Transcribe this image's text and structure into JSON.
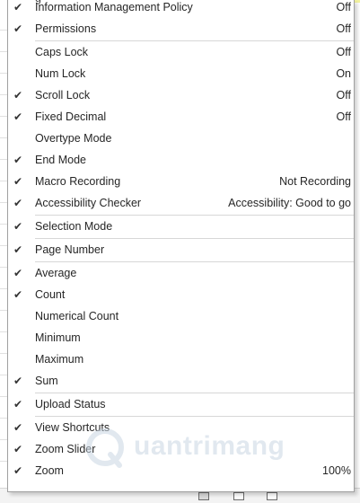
{
  "menu": {
    "partial_top": "g",
    "items": [
      {
        "label": "Information Management Policy",
        "value": "Off",
        "checked": true
      },
      {
        "label": "Permissions",
        "value": "Off",
        "checked": true
      },
      {
        "label": "Caps Lock",
        "value": "Off",
        "checked": false
      },
      {
        "label": "Num Lock",
        "value": "On",
        "checked": false
      },
      {
        "label": "Scroll Lock",
        "value": "Off",
        "checked": true
      },
      {
        "label": "Fixed Decimal",
        "value": "Off",
        "checked": true
      },
      {
        "label": "Overtype Mode",
        "value": "",
        "checked": false
      },
      {
        "label": "End Mode",
        "value": "",
        "checked": true
      },
      {
        "label": "Macro Recording",
        "value": "Not Recording",
        "checked": true
      },
      {
        "label": "Accessibility Checker",
        "value": "Accessibility: Good to go",
        "checked": true
      },
      {
        "label": "Selection Mode",
        "value": "",
        "checked": true
      },
      {
        "label": "Page Number",
        "value": "",
        "checked": true
      },
      {
        "label": "Average",
        "value": "",
        "checked": true
      },
      {
        "label": "Count",
        "value": "",
        "checked": true
      },
      {
        "label": "Numerical Count",
        "value": "",
        "checked": false
      },
      {
        "label": "Minimum",
        "value": "",
        "checked": false
      },
      {
        "label": "Maximum",
        "value": "",
        "checked": false
      },
      {
        "label": "Sum",
        "value": "",
        "checked": true
      },
      {
        "label": "Upload Status",
        "value": "",
        "checked": true
      },
      {
        "label": "View Shortcuts",
        "value": "",
        "checked": true
      },
      {
        "label": "Zoom Slider",
        "value": "",
        "checked": true
      },
      {
        "label": "Zoom",
        "value": "100%",
        "checked": true
      }
    ]
  },
  "check_glyph": "✔",
  "watermark": {
    "text": "uantrimang",
    "icon": "quantrimang-logo-icon"
  }
}
